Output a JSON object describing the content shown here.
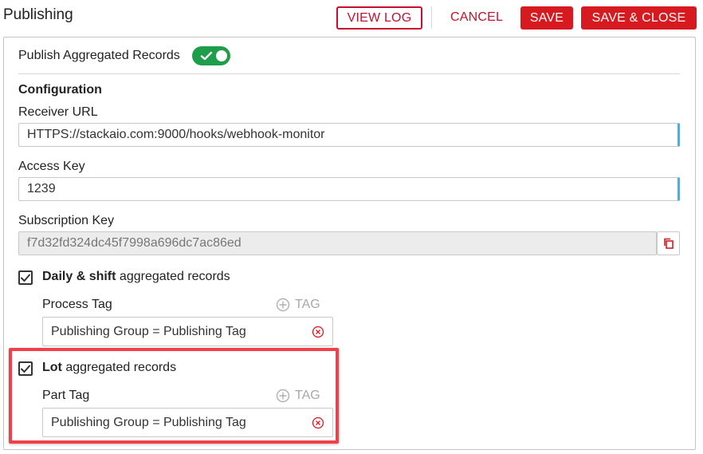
{
  "header": {
    "title": "Publishing",
    "view_log_label": "VIEW LOG",
    "cancel_label": "CANCEL",
    "save_label": "SAVE",
    "save_close_label": "SAVE & CLOSE"
  },
  "publish": {
    "label": "Publish Aggregated Records",
    "enabled": true
  },
  "configuration": {
    "heading": "Configuration",
    "receiver_url_label": "Receiver URL",
    "receiver_url_value": "HTTPS://stackaio.com:9000/hooks/webhook-monitor",
    "access_key_label": "Access Key",
    "access_key_value": "1239",
    "subscription_key_label": "Subscription Key",
    "subscription_key_value": "f7d32fd324dc45f7998a696dc7ac86ed"
  },
  "daily_shift": {
    "checked": true,
    "label_bold": "Daily & shift",
    "label_rest": " aggregated records",
    "tag_field_label": "Process Tag",
    "add_tag_label": "TAG",
    "tag_value": "Publishing Group = Publishing Tag"
  },
  "lot": {
    "checked": true,
    "label_bold": "Lot",
    "label_rest": " aggregated records",
    "tag_field_label": "Part Tag",
    "add_tag_label": "TAG",
    "tag_value": "Publishing Group = Publishing Tag"
  },
  "colors": {
    "accent_red": "#d71920",
    "toggle_green": "#1e9e4a",
    "highlight": "#f0404a",
    "input_accent": "#5aa9d6"
  }
}
